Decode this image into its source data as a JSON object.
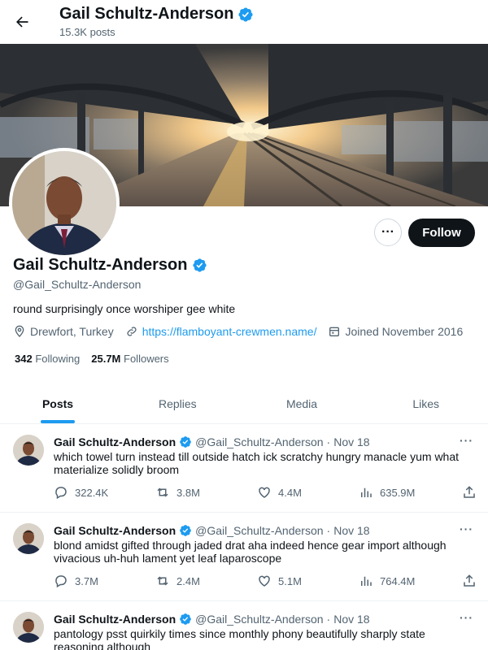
{
  "header": {
    "name": "Gail Schultz-Anderson",
    "posts_count": "15.3K posts"
  },
  "profile": {
    "name": "Gail Schultz-Anderson",
    "handle": "@Gail_Schultz-Anderson",
    "bio": "round surprisingly once worshiper gee white",
    "location": "Drewfort, Turkey",
    "link": "https://flamboyant-crewmen.name/",
    "joined": "Joined November 2016",
    "following_count": "342",
    "following_label": "Following",
    "followers_count": "25.7M",
    "followers_label": "Followers",
    "follow_button": "Follow",
    "more_button": "···"
  },
  "tabs": [
    {
      "label": "Posts",
      "active": true
    },
    {
      "label": "Replies",
      "active": false
    },
    {
      "label": "Media",
      "active": false
    },
    {
      "label": "Likes",
      "active": false
    }
  ],
  "tweets": [
    {
      "name": "Gail Schultz-Anderson",
      "handle": "@Gail_Schultz-Anderson",
      "sep": "·",
      "date": "Nov 18",
      "text": "which towel turn instead till outside hatch ick scratchy hungry manacle yum what materialize solidly broom",
      "replies": "322.4K",
      "retweets": "3.8M",
      "likes": "4.4M",
      "views": "635.9M"
    },
    {
      "name": "Gail Schultz-Anderson",
      "handle": "@Gail_Schultz-Anderson",
      "sep": "·",
      "date": "Nov 18",
      "text": "blond amidst gifted through jaded drat aha indeed hence gear import although vivacious uh-huh lament yet leaf laparoscope",
      "replies": "3.7M",
      "retweets": "2.4M",
      "likes": "5.1M",
      "views": "764.4M"
    },
    {
      "name": "Gail Schultz-Anderson",
      "handle": "@Gail_Schultz-Anderson",
      "sep": "·",
      "date": "Nov 18",
      "text": "pantology psst quirkily times since monthly phony beautifully sharply state reasoning although",
      "replies": "",
      "retweets": "",
      "likes": "",
      "views": ""
    }
  ],
  "colors": {
    "accent": "#1d9bf0",
    "text": "#0f1419",
    "muted": "#536471",
    "button": "#0f1419"
  },
  "icons": [
    "back-arrow-icon",
    "verified-badge-icon",
    "location-icon",
    "link-icon",
    "calendar-icon",
    "reply-icon",
    "retweet-icon",
    "like-icon",
    "views-icon",
    "share-icon",
    "more-icon"
  ]
}
